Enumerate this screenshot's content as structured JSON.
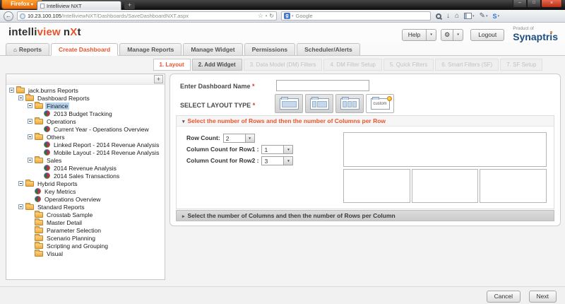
{
  "icons": {
    "caret_down": "▾",
    "caret_right": "▸",
    "home": "⌂",
    "back_arrow": "←",
    "reload": "↻",
    "star": "☆",
    "download": "↓",
    "pencil": "✎",
    "gear": "⚙",
    "minimize": "–",
    "maximize": "□",
    "close": "×",
    "plus": "+",
    "google_g": "g",
    "s_brand": "S"
  },
  "browser": {
    "firefox_button": "Firefox",
    "tab_title": "Intelliview NXT",
    "new_tab": "+",
    "url_host": "10.23.100.105",
    "url_path": "/IntelliviewNXT/Dashboards/SaveDashboardNXT.aspx",
    "search_placeholder": "Google"
  },
  "header": {
    "logo_intelli": "intelli",
    "logo_view": "view",
    "logo_n": "n",
    "logo_x": "X",
    "logo_t": "t",
    "help_label": "Help",
    "logout_label": "Logout",
    "product_of": "Product of",
    "brand": "Synaptris"
  },
  "tabs": [
    {
      "label": "Reports",
      "icon": "home",
      "active": false
    },
    {
      "label": "Create Dashboard",
      "active": true
    },
    {
      "label": "Manage Reports",
      "active": false
    },
    {
      "label": "Manage Widget",
      "active": false
    },
    {
      "label": "Permissions",
      "active": false
    },
    {
      "label": "Scheduler/Alerts",
      "active": false
    }
  ],
  "steps": [
    {
      "label": "1. Layout",
      "state": "active"
    },
    {
      "label": "2. Add Widget",
      "state": "enabled"
    },
    {
      "label": "3. Data Model (DM) Filters",
      "state": "disabled"
    },
    {
      "label": "4. DM Filter Setup",
      "state": "disabled"
    },
    {
      "label": "5. Quick Filters",
      "state": "disabled"
    },
    {
      "label": "6. Smart Filters (SF)",
      "state": "disabled"
    },
    {
      "label": "7. SF Setup",
      "state": "disabled"
    }
  ],
  "tree": {
    "expand_button": "+",
    "items": [
      {
        "label": "jack.burns Reports",
        "level": 0,
        "type": "folder",
        "expander": true
      },
      {
        "label": "Dashboard Reports",
        "level": 1,
        "type": "folder",
        "expander": true
      },
      {
        "label": "Finance",
        "level": 2,
        "type": "folder",
        "expander": true,
        "selected": true
      },
      {
        "label": "2013 Budget Tracking",
        "level": 3,
        "type": "report"
      },
      {
        "label": "Operations",
        "level": 2,
        "type": "folder",
        "expander": true
      },
      {
        "label": "Current Year - Operations Overview",
        "level": 3,
        "type": "report"
      },
      {
        "label": "Others",
        "level": 2,
        "type": "folder",
        "expander": true
      },
      {
        "label": "Linked Report - 2014 Revenue Analysis",
        "level": 3,
        "type": "report"
      },
      {
        "label": "Mobile Layout - 2014 Revenue Analysis",
        "level": 3,
        "type": "report"
      },
      {
        "label": "Sales",
        "level": 2,
        "type": "folder",
        "expander": true
      },
      {
        "label": "2014 Revenue Analysis",
        "level": 3,
        "type": "report"
      },
      {
        "label": "2014 Sales Transactions",
        "level": 3,
        "type": "report"
      },
      {
        "label": "Hybrid Reports",
        "level": 1,
        "type": "folder",
        "expander": true
      },
      {
        "label": "Key Metrics",
        "level": 2,
        "type": "report"
      },
      {
        "label": "Operations Overview",
        "level": 2,
        "type": "report"
      },
      {
        "label": "Standard Reports",
        "level": 1,
        "type": "folder",
        "expander": true
      },
      {
        "label": "Crosstab Sample",
        "level": 2,
        "type": "folder"
      },
      {
        "label": "Master Detail",
        "level": 2,
        "type": "folder"
      },
      {
        "label": "Parameter Selection",
        "level": 2,
        "type": "folder"
      },
      {
        "label": "Scenario Planning",
        "level": 2,
        "type": "folder"
      },
      {
        "label": "Scripting and Grouping",
        "level": 2,
        "type": "folder"
      },
      {
        "label": "Visual",
        "level": 2,
        "type": "folder"
      }
    ]
  },
  "form": {
    "dashboard_name_label": "Enter Dashboard Name",
    "required_marker": "*",
    "dashboard_name_value": "",
    "layout_type_label": "SELECT LAYOUT TYPE",
    "layout_options": [
      {
        "name": "one-column",
        "selected": false
      },
      {
        "name": "two-column",
        "selected": false
      },
      {
        "name": "three-column",
        "selected": false
      },
      {
        "name": "custom",
        "selected": true,
        "label": "custom"
      }
    ],
    "accordion_rows": {
      "title": "Select the number of Rows and then the number of Columns per Row",
      "expanded": true,
      "row_count_label": "Row Count:",
      "row_count_value": "2",
      "col_row1_label": "Column Count for Row1 :",
      "col_row1_value": "1",
      "col_row2_label": "Column Count for Row2 :",
      "col_row2_value": "3",
      "preview": {
        "rows": [
          {
            "columns": 1
          },
          {
            "columns": 3
          }
        ]
      }
    },
    "accordion_columns": {
      "title": "Select the number of Columns and then the number of Rows per Column",
      "expanded": false
    }
  },
  "footer": {
    "cancel_label": "Cancel",
    "next_label": "Next"
  },
  "colors": {
    "accent_orange": "#e8542c",
    "brand_blue": "#1c4e80",
    "required_red": "#e03131",
    "tree_selection": "#b5d2ee"
  }
}
